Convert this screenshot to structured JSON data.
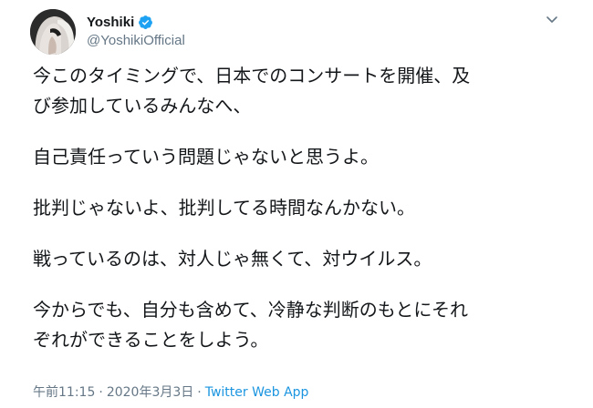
{
  "user": {
    "display_name": "Yoshiki",
    "handle": "@YoshikiOfficial",
    "verified": true,
    "avatar_icon": "profile-photo-avatar"
  },
  "tweet": {
    "paragraphs": [
      [
        "今このタイミングで、日本でのコンサートを開催、及",
        "び参加しているみんなへ、"
      ],
      [
        "自己責任っていう問題じゃないと思うよ。"
      ],
      [
        "批判じゃないよ、批判してる時間なんかない。"
      ],
      [
        "戦っているのは、対人じゃ無くて、対ウイルス。"
      ],
      [
        "今からでも、自分も含めて、冷静な判断のもとにそれ",
        "ぞれができることをしよう。"
      ]
    ]
  },
  "meta": {
    "time": "午前11:15",
    "separator": "·",
    "date": "2020年3月3日",
    "source": "Twitter Web App"
  },
  "colors": {
    "text": "#14171a",
    "secondary": "#657786",
    "link": "#1b95e0",
    "verified_badge": "#1da1f2"
  },
  "icons": {
    "verified": "verified-badge-icon",
    "menu": "chevron-down-icon"
  }
}
